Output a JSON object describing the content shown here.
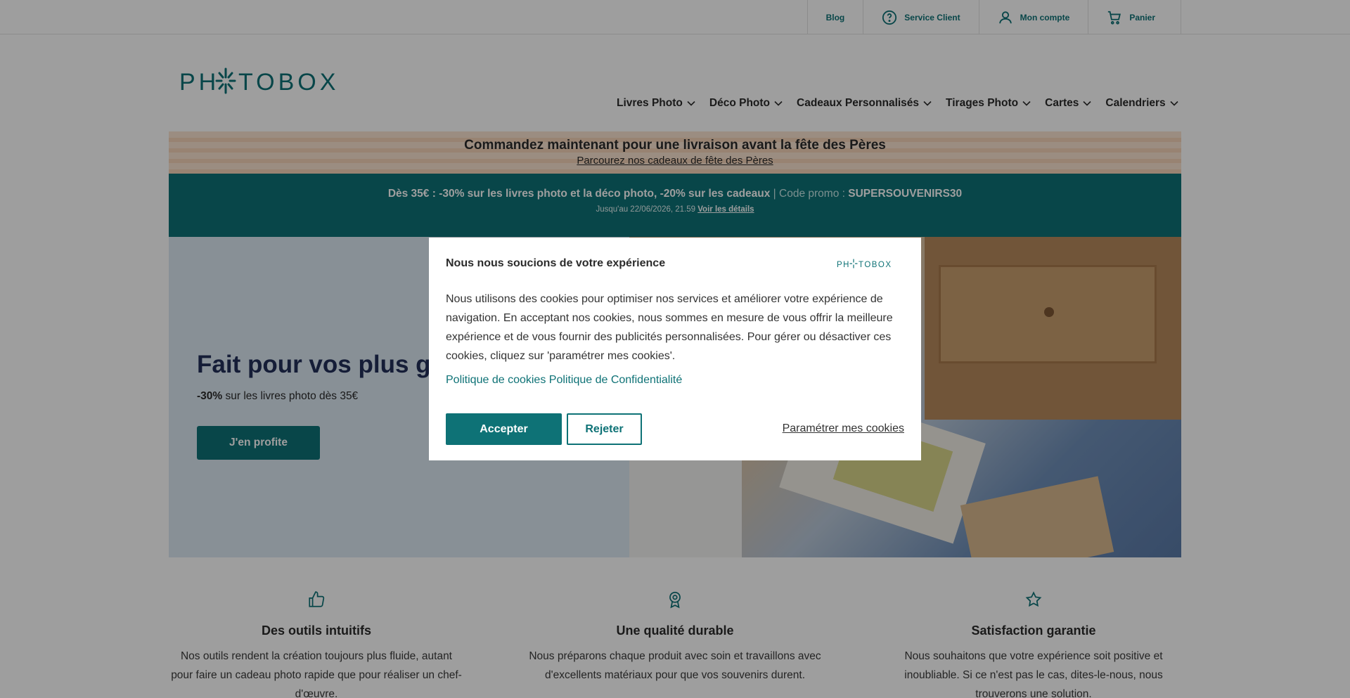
{
  "topbar": {
    "blog": "Blog",
    "service": "Service Client",
    "account": "Mon compte",
    "cart": "Panier"
  },
  "logo": {
    "text": "PHOTOBOX"
  },
  "nav": {
    "items": [
      {
        "label": "Livres Photo"
      },
      {
        "label": "Déco Photo"
      },
      {
        "label": "Cadeaux Personnalisés"
      },
      {
        "label": "Tirages Photo"
      },
      {
        "label": "Cartes"
      },
      {
        "label": "Calendriers"
      }
    ]
  },
  "banner_peach": {
    "title": "Commandez maintenant pour une livraison avant la fête des Pères",
    "link": "Parcourez nos cadeaux de fête des Pères"
  },
  "banner_teal": {
    "offer": "Dès 35€ : -30% sur les livres photo et la déco photo, -20% sur les cadeaux",
    "sep": " | Code promo : ",
    "code": "SUPERSOUVENIRS30",
    "until": "Jusqu'au 22/06/2026, 21.59 ",
    "details": "Voir les détails"
  },
  "hero": {
    "title": "Fait pour vos plus grands souvenirs",
    "sub_bold": "-30%",
    "sub_rest": " sur les livres photo dès 35€",
    "cta": "J'en profite"
  },
  "features": [
    {
      "icon": "thumbs-up-icon",
      "title": "Des outils intuitifs",
      "text": "Nos outils rendent la création toujours plus fluide, autant pour faire un cadeau photo rapide que pour réaliser un chef-d'œuvre."
    },
    {
      "icon": "award-icon",
      "title": "Une qualité durable",
      "text": "Nous préparons chaque produit avec soin et travaillons avec d'excellents matériaux pour que vos souvenirs durent."
    },
    {
      "icon": "star-icon",
      "title": "Satisfaction garantie",
      "text": "Nous souhaitons que votre expérience soit positive et inoubliable. Si ce n'est pas le cas, dites-le-nous, nous trouverons une solution."
    }
  ],
  "cookie_modal": {
    "title": "Nous nous soucions de votre expérience",
    "logo": "PHOTOBOX",
    "body": "Nous utilisons des cookies pour optimiser nos services et améliorer votre expérience de navigation. En acceptant nos cookies, nous sommes en mesure de vous offrir la meilleure expérience et de vous fournir des publicités personnalisées. Pour gérer ou désactiver ces cookies, cliquez sur 'paramétrer mes cookies'.",
    "link_cookies": "Politique de cookies",
    "link_privacy": "Politique de Confidentialité",
    "accept": "Accepter",
    "reject": "Rejeter",
    "settings": "Paramétrer mes cookies"
  },
  "colors": {
    "brand_teal": "#0e7276",
    "navy": "#23305a",
    "peach": "#fbe4d1"
  }
}
